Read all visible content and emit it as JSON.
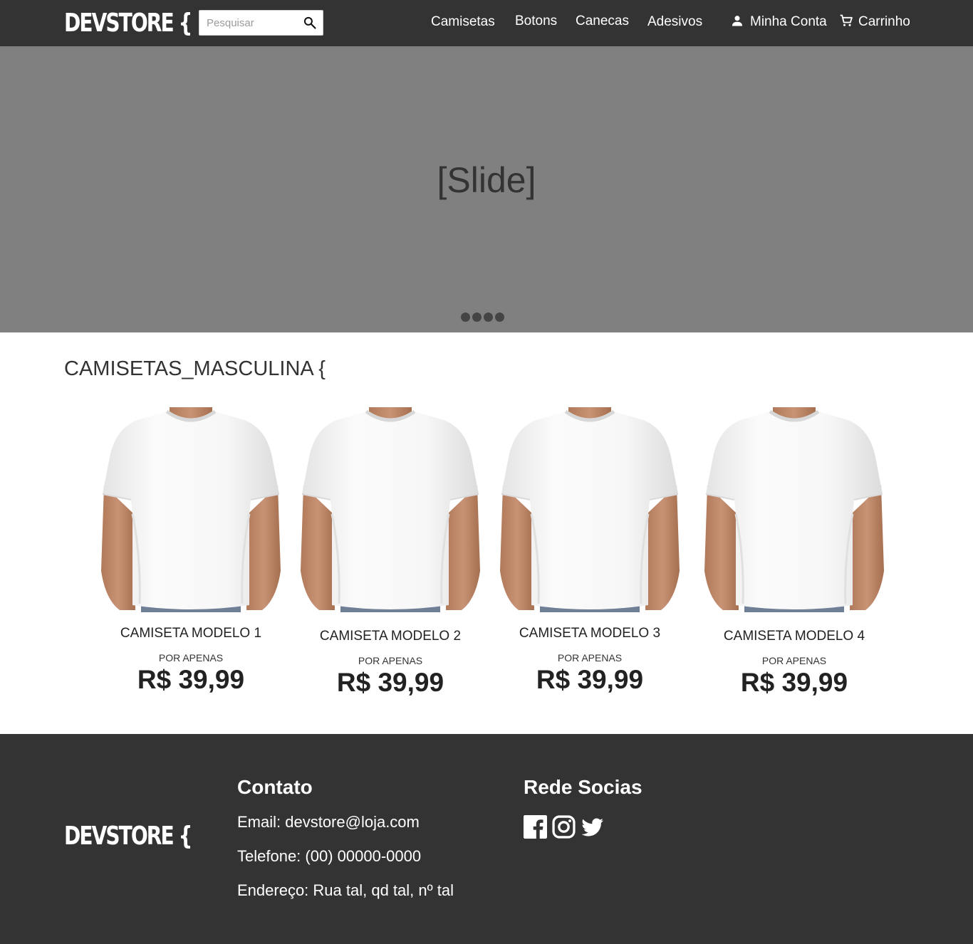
{
  "header": {
    "logo": "DEVSTORE {",
    "search": {
      "placeholder": "Pesquisar",
      "value": "",
      "icon": "search-icon"
    },
    "nav": [
      {
        "label": "Camisetas"
      },
      {
        "label": "Botons"
      },
      {
        "label": "Canecas"
      },
      {
        "label": "Adesivos"
      }
    ],
    "account": {
      "label": "Minha Conta",
      "icon": "user-icon"
    },
    "cart": {
      "label": "Carrinho",
      "icon": "cart-icon"
    }
  },
  "hero": {
    "text": "[Slide]",
    "dot_count": 4
  },
  "section": {
    "title": "CAMISETAS_MASCULINA {",
    "products": [
      {
        "name": "CAMISETA MODELO 1",
        "price_prefix": "POR APENAS",
        "price": "R$ 39,99"
      },
      {
        "name": "CAMISETA MODELO 2",
        "price_prefix": "POR APENAS",
        "price": "R$ 39,99"
      },
      {
        "name": "CAMISETA MODELO 3",
        "price_prefix": "POR APENAS",
        "price": "R$ 39,99"
      },
      {
        "name": "CAMISETA MODELO 4",
        "price_prefix": "POR APENAS",
        "price": "R$ 39,99"
      }
    ]
  },
  "footer": {
    "logo": "DEVSTORE {",
    "contact": {
      "heading": "Contato",
      "email": "Email: devstore@loja.com",
      "phone": "Telefone: (00) 00000-0000",
      "address": "Endereço: Rua tal, qd tal, nº tal"
    },
    "social": {
      "heading": "Rede Socias",
      "icons": [
        "facebook-icon",
        "instagram-icon",
        "twitter-icon"
      ]
    }
  },
  "colors": {
    "header_bg": "#333333",
    "hero_bg": "#808080",
    "footer_bg": "#333333",
    "text_dark": "#333333"
  }
}
